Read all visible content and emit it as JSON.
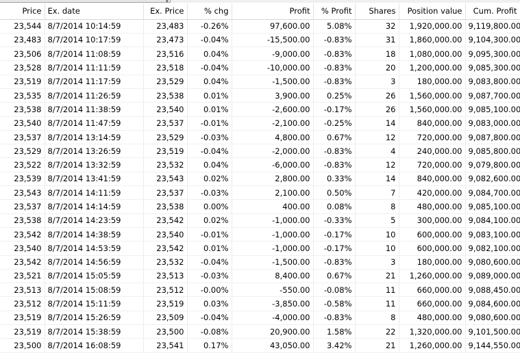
{
  "columns": [
    "Price",
    "Ex. date",
    "Ex. Price",
    "% chg",
    "Profit",
    "% Profit",
    "Shares",
    "Position value",
    "Cum. Profit"
  ],
  "rows": [
    [
      "23,544",
      "8/7/2014 10:14:59",
      "23,483",
      "-0.26%",
      "97,600.00",
      "5.08%",
      "32",
      "1,920,000.00",
      "9,119,800.00"
    ],
    [
      "23,483",
      "8/7/2014 10:17:59",
      "23,473",
      "-0.04%",
      "-15,500.00",
      "-0.83%",
      "31",
      "1,860,000.00",
      "9,104,300.00"
    ],
    [
      "23,506",
      "8/7/2014 11:08:59",
      "23,516",
      "0.04%",
      "-9,000.00",
      "-0.83%",
      "18",
      "1,080,000.00",
      "9,095,300.00"
    ],
    [
      "23,528",
      "8/7/2014 11:11:59",
      "23,518",
      "-0.04%",
      "-10,000.00",
      "-0.83%",
      "20",
      "1,200,000.00",
      "9,085,300.00"
    ],
    [
      "23,519",
      "8/7/2014 11:17:59",
      "23,529",
      "0.04%",
      "-1,500.00",
      "-0.83%",
      "3",
      "180,000.00",
      "9,083,800.00"
    ],
    [
      "23,535",
      "8/7/2014 11:26:59",
      "23,538",
      "0.01%",
      "3,900.00",
      "0.25%",
      "26",
      "1,560,000.00",
      "9,087,700.00"
    ],
    [
      "23,538",
      "8/7/2014 11:38:59",
      "23,540",
      "0.01%",
      "-2,600.00",
      "-0.17%",
      "26",
      "1,560,000.00",
      "9,085,100.00"
    ],
    [
      "23,540",
      "8/7/2014 11:47:59",
      "23,537",
      "-0.01%",
      "-2,100.00",
      "-0.25%",
      "14",
      "840,000.00",
      "9,083,000.00"
    ],
    [
      "23,537",
      "8/7/2014 13:14:59",
      "23,529",
      "-0.03%",
      "4,800.00",
      "0.67%",
      "12",
      "720,000.00",
      "9,087,800.00"
    ],
    [
      "23,529",
      "8/7/2014 13:26:59",
      "23,519",
      "-0.04%",
      "-2,000.00",
      "-0.83%",
      "4",
      "240,000.00",
      "9,085,800.00"
    ],
    [
      "23,522",
      "8/7/2014 13:32:59",
      "23,532",
      "0.04%",
      "-6,000.00",
      "-0.83%",
      "12",
      "720,000.00",
      "9,079,800.00"
    ],
    [
      "23,539",
      "8/7/2014 13:41:59",
      "23,543",
      "0.02%",
      "2,800.00",
      "0.33%",
      "14",
      "840,000.00",
      "9,082,600.00"
    ],
    [
      "23,543",
      "8/7/2014 14:11:59",
      "23,537",
      "-0.03%",
      "2,100.00",
      "0.50%",
      "7",
      "420,000.00",
      "9,084,700.00"
    ],
    [
      "23,537",
      "8/7/2014 14:14:59",
      "23,538",
      "0.00%",
      "400.00",
      "0.08%",
      "8",
      "480,000.00",
      "9,085,100.00"
    ],
    [
      "23,538",
      "8/7/2014 14:23:59",
      "23,542",
      "0.02%",
      "-1,000.00",
      "-0.33%",
      "5",
      "300,000.00",
      "9,084,100.00"
    ],
    [
      "23,542",
      "8/7/2014 14:38:59",
      "23,540",
      "-0.01%",
      "-1,000.00",
      "-0.17%",
      "10",
      "600,000.00",
      "9,083,100.00"
    ],
    [
      "23,540",
      "8/7/2014 14:53:59",
      "23,542",
      "0.01%",
      "-1,000.00",
      "-0.17%",
      "10",
      "600,000.00",
      "9,082,100.00"
    ],
    [
      "23,542",
      "8/7/2014 14:56:59",
      "23,532",
      "-0.04%",
      "-1,500.00",
      "-0.83%",
      "3",
      "180,000.00",
      "9,080,600.00"
    ],
    [
      "23,521",
      "8/7/2014 15:05:59",
      "23,513",
      "-0.03%",
      "8,400.00",
      "0.67%",
      "21",
      "1,260,000.00",
      "9,089,000.00"
    ],
    [
      "23,513",
      "8/7/2014 15:08:59",
      "23,512",
      "-0.00%",
      "-550.00",
      "-0.08%",
      "11",
      "660,000.00",
      "9,088,450.00"
    ],
    [
      "23,512",
      "8/7/2014 15:11:59",
      "23,519",
      "0.03%",
      "-3,850.00",
      "-0.58%",
      "11",
      "660,000.00",
      "9,084,600.00"
    ],
    [
      "23,519",
      "8/7/2014 15:26:59",
      "23,509",
      "-0.04%",
      "-4,000.00",
      "-0.83%",
      "8",
      "480,000.00",
      "9,080,600.00"
    ],
    [
      "23,519",
      "8/7/2014 15:38:59",
      "23,500",
      "-0.08%",
      "20,900.00",
      "1.58%",
      "22",
      "1,320,000.00",
      "9,101,500.00"
    ],
    [
      "23,500",
      "8/7/2014 16:08:59",
      "23,541",
      "0.17%",
      "43,050.00",
      "3.42%",
      "21",
      "1,260,000.00",
      "9,144,550.00"
    ]
  ]
}
